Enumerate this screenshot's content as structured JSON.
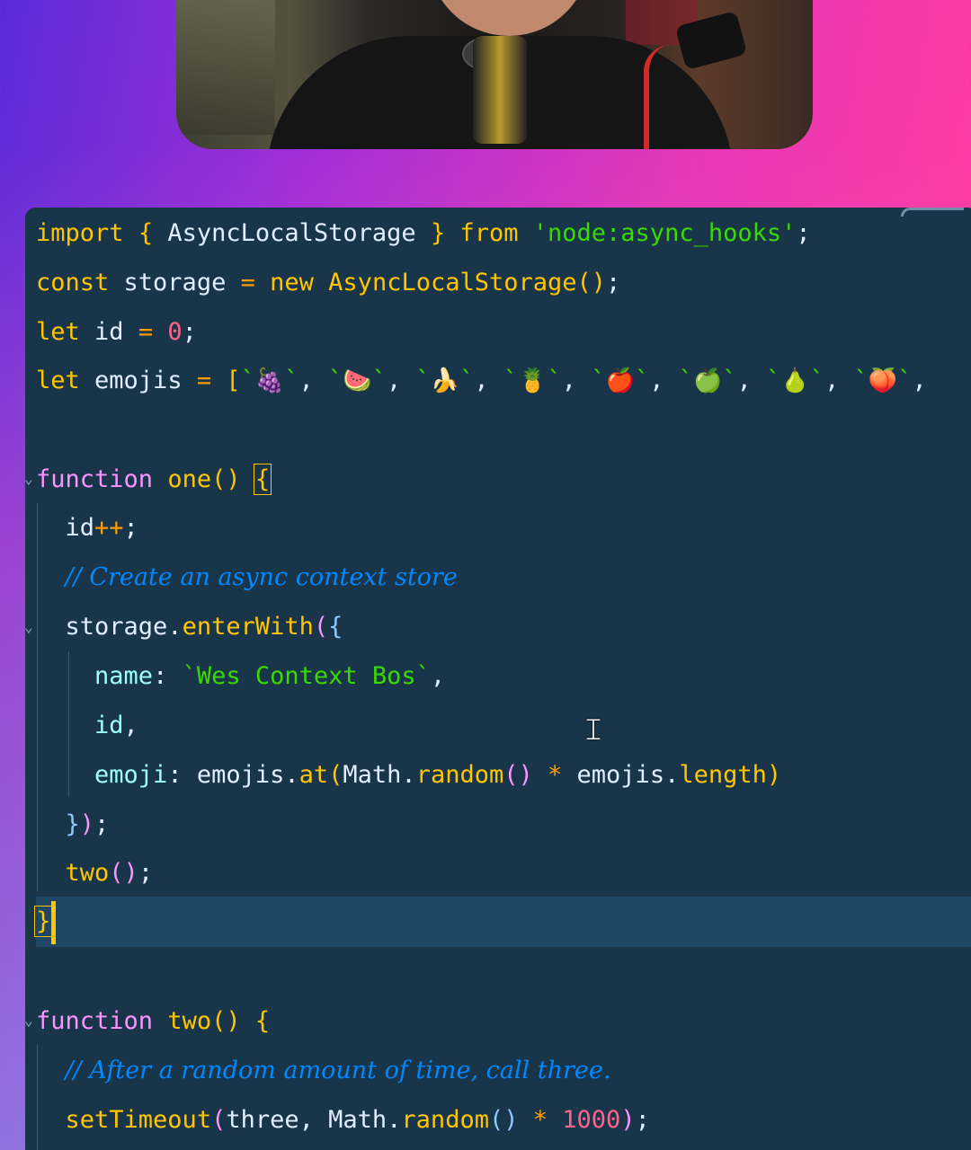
{
  "editor": {
    "code_lines": [
      {
        "id": "l1",
        "parts": [
          {
            "t": "import",
            "c": "kw"
          },
          {
            "t": " ",
            "c": "p"
          },
          {
            "t": "{",
            "c": "brk"
          },
          {
            "t": " AsyncLocalStorage ",
            "c": "p"
          },
          {
            "t": "}",
            "c": "brk"
          },
          {
            "t": " ",
            "c": "p"
          },
          {
            "t": "from",
            "c": "kw"
          },
          {
            "t": " ",
            "c": "p"
          },
          {
            "t": "'node:async_hooks'",
            "c": "str"
          },
          {
            "t": ";",
            "c": "p"
          }
        ]
      },
      {
        "id": "l2",
        "parts": [
          {
            "t": "const",
            "c": "kw"
          },
          {
            "t": " storage ",
            "c": "p"
          },
          {
            "t": "=",
            "c": "op"
          },
          {
            "t": " ",
            "c": "p"
          },
          {
            "t": "new",
            "c": "kw"
          },
          {
            "t": " ",
            "c": "p"
          },
          {
            "t": "AsyncLocalStorage",
            "c": "fn"
          },
          {
            "t": "()",
            "c": "brk"
          },
          {
            "t": ";",
            "c": "p"
          }
        ]
      },
      {
        "id": "l3",
        "parts": [
          {
            "t": "let",
            "c": "kw"
          },
          {
            "t": " id ",
            "c": "p"
          },
          {
            "t": "=",
            "c": "op"
          },
          {
            "t": " ",
            "c": "p"
          },
          {
            "t": "0",
            "c": "num"
          },
          {
            "t": ";",
            "c": "p"
          }
        ]
      },
      {
        "id": "l4",
        "parts": [
          {
            "t": "let",
            "c": "kw"
          },
          {
            "t": " emojis ",
            "c": "p"
          },
          {
            "t": "=",
            "c": "op"
          },
          {
            "t": " ",
            "c": "p"
          },
          {
            "t": "[",
            "c": "brk"
          },
          {
            "t": "`",
            "c": "str"
          },
          {
            "t": "🍇",
            "c": "emo"
          },
          {
            "t": "`",
            "c": "str"
          },
          {
            "t": ", ",
            "c": "p"
          },
          {
            "t": "`",
            "c": "str"
          },
          {
            "t": "🍉",
            "c": "emo"
          },
          {
            "t": "`",
            "c": "str"
          },
          {
            "t": ", ",
            "c": "p"
          },
          {
            "t": "`",
            "c": "str"
          },
          {
            "t": "🍌",
            "c": "emo"
          },
          {
            "t": "`",
            "c": "str"
          },
          {
            "t": ", ",
            "c": "p"
          },
          {
            "t": "`",
            "c": "str"
          },
          {
            "t": "🍍",
            "c": "emo"
          },
          {
            "t": "`",
            "c": "str"
          },
          {
            "t": ", ",
            "c": "p"
          },
          {
            "t": "`",
            "c": "str"
          },
          {
            "t": "🍎",
            "c": "emo"
          },
          {
            "t": "`",
            "c": "str"
          },
          {
            "t": ", ",
            "c": "p"
          },
          {
            "t": "`",
            "c": "str"
          },
          {
            "t": "🍏",
            "c": "emo"
          },
          {
            "t": "`",
            "c": "str"
          },
          {
            "t": ", ",
            "c": "p"
          },
          {
            "t": "`",
            "c": "str"
          },
          {
            "t": "🍐",
            "c": "emo"
          },
          {
            "t": "`",
            "c": "str"
          },
          {
            "t": ", ",
            "c": "p"
          },
          {
            "t": "`",
            "c": "str"
          },
          {
            "t": "🍑",
            "c": "emo"
          },
          {
            "t": "`",
            "c": "str"
          },
          {
            "t": ",",
            "c": "p"
          }
        ]
      },
      {
        "id": "l6",
        "parts": [
          {
            "t": "function",
            "c": "purple"
          },
          {
            "t": " ",
            "c": "p"
          },
          {
            "t": "one",
            "c": "fn"
          },
          {
            "t": "()",
            "c": "brk"
          },
          {
            "t": " ",
            "c": "p"
          },
          {
            "t": "{",
            "c": "brk bracket-box"
          }
        ]
      },
      {
        "id": "l7",
        "parts": [
          {
            "t": "  id",
            "c": "p"
          },
          {
            "t": "++",
            "c": "op"
          },
          {
            "t": ";",
            "c": "p"
          }
        ]
      },
      {
        "id": "l8",
        "parts": [
          {
            "t": "  ",
            "c": "p"
          },
          {
            "t": "// Create an async context store",
            "c": "cm"
          }
        ]
      },
      {
        "id": "l9",
        "parts": [
          {
            "t": "  storage.",
            "c": "p"
          },
          {
            "t": "enterWith",
            "c": "fn"
          },
          {
            "t": "(",
            "c": "purple"
          },
          {
            "t": "{",
            "c": "brk3"
          }
        ]
      },
      {
        "id": "l10",
        "parts": [
          {
            "t": "    ",
            "c": "p"
          },
          {
            "t": "name",
            "c": "prop"
          },
          {
            "t": ": ",
            "c": "p"
          },
          {
            "t": "`Wes Context Bos`",
            "c": "str"
          },
          {
            "t": ",",
            "c": "p"
          }
        ]
      },
      {
        "id": "l11",
        "parts": [
          {
            "t": "    ",
            "c": "p"
          },
          {
            "t": "id",
            "c": "prop"
          },
          {
            "t": ",",
            "c": "p"
          }
        ]
      },
      {
        "id": "l12",
        "parts": [
          {
            "t": "    ",
            "c": "p"
          },
          {
            "t": "emoji",
            "c": "prop"
          },
          {
            "t": ": emojis.",
            "c": "p"
          },
          {
            "t": "at",
            "c": "fn"
          },
          {
            "t": "(",
            "c": "brk"
          },
          {
            "t": "Math.",
            "c": "p"
          },
          {
            "t": "random",
            "c": "fn"
          },
          {
            "t": "()",
            "c": "purple"
          },
          {
            "t": " ",
            "c": "p"
          },
          {
            "t": "*",
            "c": "op"
          },
          {
            "t": " emojis.",
            "c": "p"
          },
          {
            "t": "length",
            "c": "fn"
          },
          {
            "t": ")",
            "c": "brk"
          }
        ]
      },
      {
        "id": "l13",
        "parts": [
          {
            "t": "  ",
            "c": "p"
          },
          {
            "t": "}",
            "c": "brk3"
          },
          {
            "t": ")",
            "c": "purple"
          },
          {
            "t": ";",
            "c": "p"
          }
        ]
      },
      {
        "id": "l14",
        "parts": [
          {
            "t": "  ",
            "c": "p"
          },
          {
            "t": "two",
            "c": "fn"
          },
          {
            "t": "()",
            "c": "purple"
          },
          {
            "t": ";",
            "c": "p"
          }
        ]
      },
      {
        "id": "l15",
        "parts": [
          {
            "t": "}",
            "c": "brk bracket-box"
          }
        ]
      },
      {
        "id": "l17",
        "parts": [
          {
            "t": "function",
            "c": "purple"
          },
          {
            "t": " ",
            "c": "p"
          },
          {
            "t": "two",
            "c": "fn"
          },
          {
            "t": "()",
            "c": "brk"
          },
          {
            "t": " ",
            "c": "p"
          },
          {
            "t": "{",
            "c": "brk"
          }
        ]
      },
      {
        "id": "l18",
        "parts": [
          {
            "t": "  ",
            "c": "p"
          },
          {
            "t": "// After a random amount of time, call three.",
            "c": "cm"
          }
        ]
      },
      {
        "id": "l19",
        "parts": [
          {
            "t": "  ",
            "c": "p"
          },
          {
            "t": "setTimeout",
            "c": "fn"
          },
          {
            "t": "(",
            "c": "purple"
          },
          {
            "t": "three, Math.",
            "c": "p"
          },
          {
            "t": "random",
            "c": "fn"
          },
          {
            "t": "()",
            "c": "brk3"
          },
          {
            "t": " ",
            "c": "p"
          },
          {
            "t": "*",
            "c": "op"
          },
          {
            "t": " ",
            "c": "p"
          },
          {
            "t": "1000",
            "c": "num"
          },
          {
            "t": ")",
            "c": "purple"
          },
          {
            "t": ";",
            "c": "p"
          }
        ]
      }
    ]
  },
  "colors": {
    "editor_bg": "#193549",
    "current_line": "#1f4662",
    "cursor": "#ffc600"
  },
  "icons": {
    "text_cursor": "i-beam-cursor-icon",
    "fold": "fold-chevron-icon"
  }
}
